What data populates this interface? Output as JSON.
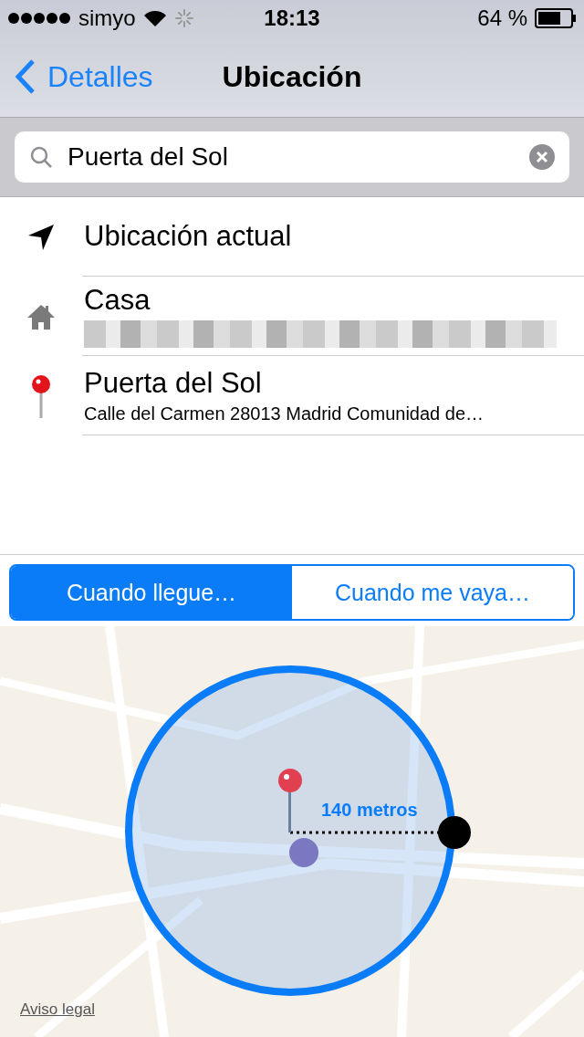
{
  "status_bar": {
    "carrier": "simyo",
    "time": "18:13",
    "battery": "64 %"
  },
  "nav": {
    "back": "Detalles",
    "title": "Ubicación"
  },
  "search": {
    "value": "Puerta del Sol"
  },
  "locations": [
    {
      "kind": "current",
      "title": "Ubicación actual"
    },
    {
      "kind": "home",
      "title": "Casa",
      "redacted": true
    },
    {
      "kind": "pin",
      "title": "Puerta del Sol",
      "subtitle": "Calle del Carmen 28013 Madrid Comunidad de…"
    }
  ],
  "triggers": [
    {
      "label": "Cuando llegue…",
      "selected": true
    },
    {
      "label": "Cuando me vaya…",
      "selected": false
    }
  ],
  "map": {
    "radius_label": "140 metros",
    "legal_link": "Aviso legal"
  }
}
